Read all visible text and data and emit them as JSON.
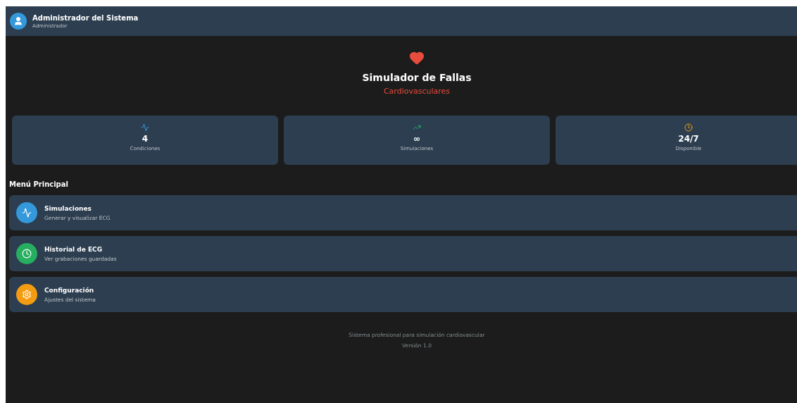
{
  "header": {
    "name": "Administrador del Sistema",
    "role": "Administrador"
  },
  "hero": {
    "title": "Simulador de Fallas",
    "subtitle": "Cardiovasculares"
  },
  "stats": [
    {
      "kind": "pulse",
      "value": "4",
      "label": "Condiciones"
    },
    {
      "kind": "trend",
      "value": "∞",
      "label": "Simulaciones"
    },
    {
      "kind": "clock",
      "value": "24/7",
      "label": "Disponible"
    }
  ],
  "menu": {
    "title": "Menú Principal",
    "items": [
      {
        "kind": "pulse",
        "color": "#3498db",
        "title": "Simulaciones",
        "subtitle": "Generar y visualizar ECG"
      },
      {
        "kind": "clock",
        "color": "#27ae60",
        "title": "Historial de ECG",
        "subtitle": "Ver grabaciones guardadas"
      },
      {
        "kind": "gear",
        "color": "#f39c12",
        "title": "Configuración",
        "subtitle": "Ajustes del sistema"
      }
    ]
  },
  "footer": {
    "text": "Sistema profesional para simulación cardiovascular",
    "version": "Versión 1.0"
  }
}
